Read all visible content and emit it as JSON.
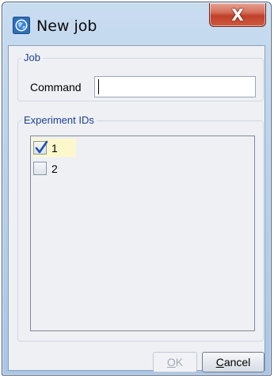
{
  "window": {
    "title": "New job",
    "close_glyph": "X",
    "icon": "app-globe-icon"
  },
  "job_group": {
    "legend": "Job",
    "command_label": "Command",
    "command_value": ""
  },
  "experiments_group": {
    "legend": "Experiment IDs",
    "items": [
      {
        "label": "1",
        "checked": true,
        "highlighted": true
      },
      {
        "label": "2",
        "checked": false,
        "highlighted": false
      }
    ]
  },
  "buttons": {
    "ok": {
      "mnemonic": "O",
      "rest": "K",
      "enabled": false
    },
    "cancel": {
      "mnemonic": "C",
      "rest": "ancel",
      "enabled": true
    }
  },
  "colors": {
    "legend": "#1c3f95",
    "highlight": "#fcf8cc",
    "check": "#1f4fb3"
  }
}
